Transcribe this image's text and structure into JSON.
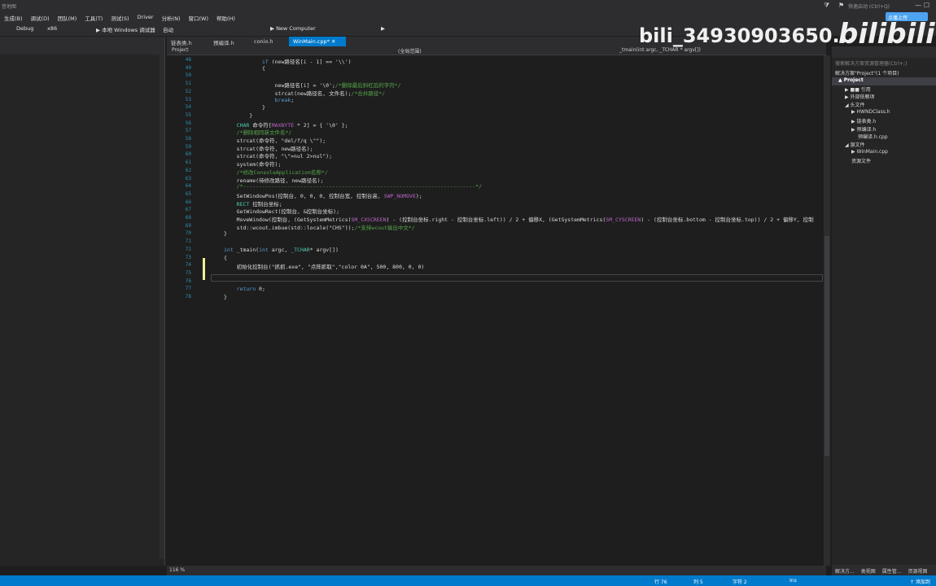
{
  "titlebar": {
    "title": "音地图",
    "quick_launch": "快速启动 (Ctrl+Q)",
    "window_controls": "—  ☐",
    "filter_icon": "filter-icon",
    "bell_icon": "bell-icon"
  },
  "menu": [
    "生成(B)",
    "调试(D)",
    "团队(M)",
    "工具(T)",
    "测试(S)",
    "Driver",
    "分析(N)",
    "窗口(W)",
    "帮助(H)"
  ],
  "upload_label": "点播上传",
  "toolbar": {
    "config": "Debug",
    "platform": "x86",
    "debugger": "▶ 本地 Windows 调试器",
    "auto": "自动",
    "device": "▶ New Computer"
  },
  "tabs": [
    {
      "label": "链表类.h",
      "active": false
    },
    {
      "label": "预编译.h",
      "active": false
    },
    {
      "label": "conio.h",
      "active": false
    },
    {
      "label": "WinMain.cpp*",
      "active": true
    }
  ],
  "navbar": {
    "project": "Project",
    "scope": "(全局范围)",
    "member": "_tmain(int argc, _TCHAR * argv[])"
  },
  "code_lines": [
    {
      "n": "48",
      "t": "            if (new路径名[i - 1] == '\\\\')"
    },
    {
      "n": "49",
      "t": "            {"
    },
    {
      "n": "50",
      "t": ""
    },
    {
      "n": "51",
      "t": "                new路径名[i] = '\\0';/*删除最后斜杠后的字符*/"
    },
    {
      "n": "52",
      "t": "                strcat(new路径名, 文件名);/*合并路径*/"
    },
    {
      "n": "53",
      "t": "                break;"
    },
    {
      "n": "54",
      "t": "            }"
    },
    {
      "n": "55",
      "t": "        }"
    },
    {
      "n": "56",
      "t": "    CHAR 命令符[MAXBYTE * 2] = { '\\0' };"
    },
    {
      "n": "57",
      "t": "    /*删除相同新文件名*/"
    },
    {
      "n": "58",
      "t": "    strcat(命令符, \"del/f/q \\\"\");"
    },
    {
      "n": "59",
      "t": "    strcat(命令符, new路径名);"
    },
    {
      "n": "60",
      "t": "    strcat(命令符, \"\\\">nul 2>nul\");"
    },
    {
      "n": "61",
      "t": "    system(命令符);"
    },
    {
      "n": "62",
      "t": "    /*修改ConsoleApplication名称*/"
    },
    {
      "n": "63",
      "t": "    rename(待修改路径, new路径名);"
    },
    {
      "n": "64",
      "t": "    /*-------------------------------------------------------------------------*/"
    },
    {
      "n": "65",
      "t": "    SetWindowPos(控制台, 0, 0, 0, 控制台宽, 控制台高, SWP_NOMOVE);"
    },
    {
      "n": "66",
      "t": "    RECT 控制台坐标;"
    },
    {
      "n": "67",
      "t": "    GetWindowRect(控制台, &控制台坐标);"
    },
    {
      "n": "68",
      "t": "    MoveWindow(控制台, (GetSystemMetrics(SM_CXSCREEN) - (控制台坐标.right - 控制台坐标.left)) / 2 + 偏移X, (GetSystemMetrics(SM_CYSCREEN) - (控制台坐标.bottom - 控制台坐标.top)) / 2 + 偏移Y, 控制"
    },
    {
      "n": "69",
      "t": "    std::wcout.imbue(std::locale(\"CHS\"));/*支持wcout输出中文*/"
    },
    {
      "n": "70",
      "t": "}"
    },
    {
      "n": "71",
      "t": ""
    },
    {
      "n": "72",
      "t": "int _tmain(int argc, _TCHAR* argv[])"
    },
    {
      "n": "73",
      "t": "{"
    },
    {
      "n": "74",
      "t": "    初始化控制台(\"抓抓.exe\", \"点阵抓取\",\"color 0A\", 500, 800, 0, 0)"
    },
    {
      "n": "75",
      "t": ""
    },
    {
      "n": "76",
      "t": ""
    },
    {
      "n": "77",
      "t": "    return 0;"
    },
    {
      "n": "78",
      "t": "}"
    }
  ],
  "zoom": "116 %",
  "solution": {
    "search_placeholder": "搜索解决方案资源管理器(Ctrl+;)",
    "items": [
      {
        "label": "解决方案\"Project\"(1 个项目)",
        "indent": 0,
        "selected": false
      },
      {
        "label": "▲ Project",
        "indent": 4,
        "selected": true
      },
      {
        "label": "▶ ■■ 引用",
        "indent": 12,
        "selected": false
      },
      {
        "label": "▶ 外部依赖项",
        "indent": 12,
        "selected": false
      },
      {
        "label": "◢ 头文件",
        "indent": 12,
        "selected": false
      },
      {
        "label": "▶ HWNDClass.h",
        "indent": 20,
        "selected": false
      },
      {
        "label": "▶ 链表类.h",
        "indent": 20,
        "selected": false
      },
      {
        "label": "▶ 预编译.h",
        "indent": 20,
        "selected": false
      },
      {
        "label": "预编译.h.cpp",
        "indent": 28,
        "selected": false
      },
      {
        "label": "◢ 源文件",
        "indent": 12,
        "selected": false
      },
      {
        "label": "▶ WinMain.cpp",
        "indent": 20,
        "selected": false
      },
      {
        "label": "资源文件",
        "indent": 20,
        "selected": false
      }
    ],
    "bottom_tabs": [
      "解决方...",
      "类视图",
      "属性管...",
      "资源视图"
    ]
  },
  "status": {
    "row": "行 76",
    "col": "列 5",
    "char": "字符 2",
    "mode": "Ins",
    "add": "↑ 添加到"
  },
  "watermark": {
    "user": "bili_34930903650...",
    "logo": "bilibili"
  }
}
